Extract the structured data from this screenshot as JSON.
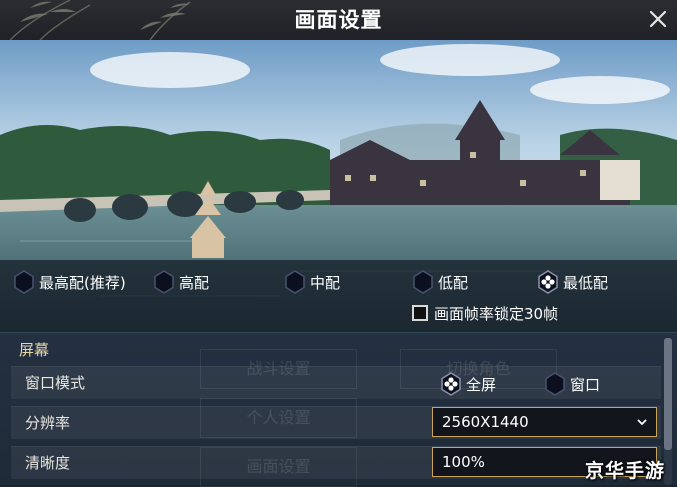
{
  "window": {
    "title": "画面设置",
    "close_icon": "close-icon"
  },
  "presets": {
    "options": [
      {
        "label": "最高配(推荐)",
        "selected": false
      },
      {
        "label": "高配",
        "selected": false
      },
      {
        "label": "中配",
        "selected": false
      },
      {
        "label": "低配",
        "selected": false
      },
      {
        "label": "最低配",
        "selected": true
      }
    ],
    "fps_lock": {
      "label": "画面帧率锁定30帧",
      "checked": false
    }
  },
  "background_menu": {
    "items": [
      "战斗设置",
      "切换角色",
      "个人设置",
      "画面设置"
    ]
  },
  "screen_section": {
    "title": "屏幕",
    "window_mode": {
      "label": "窗口模式",
      "options": [
        {
          "label": "全屏",
          "selected": true
        },
        {
          "label": "窗口",
          "selected": false
        }
      ]
    },
    "resolution": {
      "label": "分辨率",
      "value": "2560X1440"
    },
    "clarity": {
      "label": "清晰度",
      "value": "100%"
    }
  },
  "watermark": "京华手游",
  "colors": {
    "accent_gold": "#c9a45a",
    "section_title": "#e9d7a6",
    "panel_bg": "#243041"
  }
}
